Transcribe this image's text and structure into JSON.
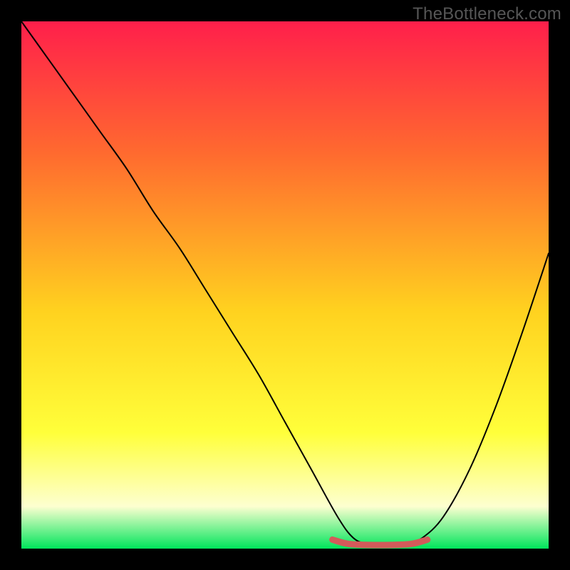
{
  "watermark": "TheBottleneck.com",
  "colors": {
    "top": "#ff1f4b",
    "upper_mid": "#ff6a2f",
    "mid": "#ffd21f",
    "lower_mid": "#ffff3a",
    "pale": "#fdffd0",
    "bottom_band": "#00e55b",
    "accent_marker": "#d35a5a",
    "curve": "#000000",
    "frame": "#000000"
  },
  "chart_data": {
    "type": "line",
    "title": "",
    "xlabel": "",
    "ylabel": "",
    "x_range": [
      0,
      100
    ],
    "y_range": [
      0,
      100
    ],
    "series": [
      {
        "name": "bottleneck-curve",
        "x": [
          0,
          5,
          10,
          15,
          20,
          25,
          30,
          35,
          40,
          45,
          50,
          55,
          60,
          63,
          66,
          70,
          73,
          76,
          80,
          85,
          90,
          95,
          100
        ],
        "y": [
          100,
          93,
          86,
          79,
          72,
          64,
          57,
          49,
          41,
          33,
          24,
          15,
          6,
          2,
          0.8,
          0.6,
          0.8,
          2,
          6,
          15,
          27,
          41,
          56
        ]
      },
      {
        "name": "sweet-spot-marker",
        "x": [
          59,
          62,
          66,
          70,
          74,
          77
        ],
        "y": [
          1.7,
          0.9,
          0.7,
          0.7,
          0.9,
          1.7
        ]
      }
    ],
    "gradient_stops": [
      {
        "pct": 0,
        "color": "#ff1f4b"
      },
      {
        "pct": 25,
        "color": "#ff6a2f"
      },
      {
        "pct": 55,
        "color": "#ffd21f"
      },
      {
        "pct": 78,
        "color": "#ffff3a"
      },
      {
        "pct": 92,
        "color": "#fdffd0"
      },
      {
        "pct": 100,
        "color": "#00e55b"
      }
    ]
  }
}
